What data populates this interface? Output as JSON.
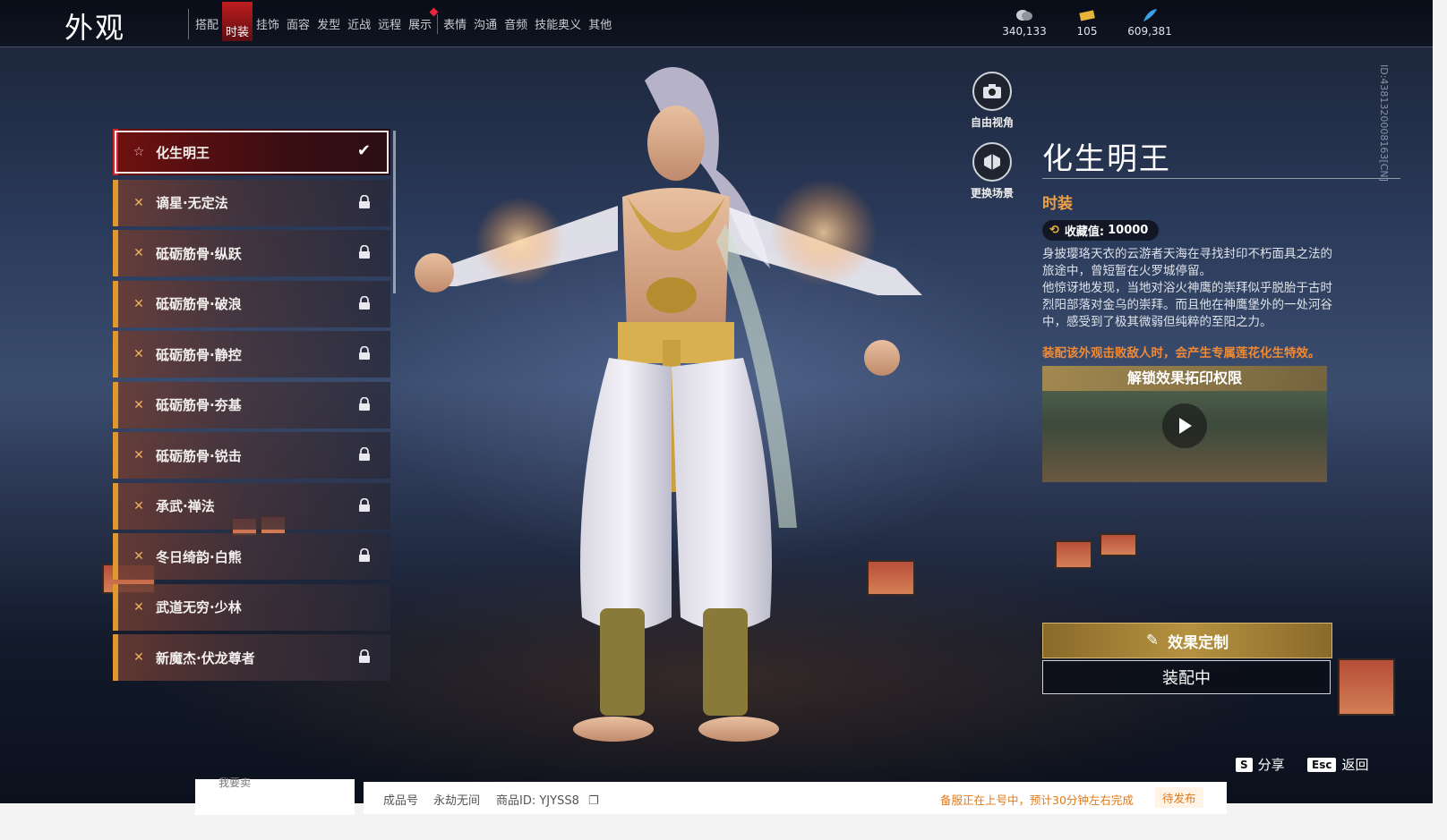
{
  "header": {
    "title": "外观",
    "tabs": [
      {
        "label": "搭配",
        "active": false
      },
      {
        "label": "时装",
        "active": true
      },
      {
        "label": "挂饰",
        "active": false
      },
      {
        "label": "面容",
        "active": false
      },
      {
        "label": "发型",
        "active": false
      },
      {
        "label": "近战",
        "active": false
      },
      {
        "label": "远程",
        "active": false
      },
      {
        "label": "展示",
        "active": false,
        "badge": true
      },
      {
        "label": "表情",
        "active": false
      },
      {
        "label": "沟通",
        "active": false
      },
      {
        "label": "音频",
        "active": false
      },
      {
        "label": "技能奥义",
        "active": false
      },
      {
        "label": "其他",
        "active": false
      }
    ],
    "currencies": [
      {
        "icon": "coin-icon",
        "value": "340,133"
      },
      {
        "icon": "ticket-icon",
        "value": "105"
      },
      {
        "icon": "feather-icon",
        "value": "609,381"
      }
    ]
  },
  "outfit_list": [
    {
      "label": "化生明王",
      "selected": true,
      "locked": false,
      "equipped": true
    },
    {
      "label": "谪星·无定法",
      "selected": false,
      "locked": true
    },
    {
      "label": "砥砺筋骨·纵跃",
      "selected": false,
      "locked": true
    },
    {
      "label": "砥砺筋骨·破浪",
      "selected": false,
      "locked": true
    },
    {
      "label": "砥砺筋骨·静控",
      "selected": false,
      "locked": true
    },
    {
      "label": "砥砺筋骨·夯基",
      "selected": false,
      "locked": true
    },
    {
      "label": "砥砺筋骨·锐击",
      "selected": false,
      "locked": true
    },
    {
      "label": "承武·禅法",
      "selected": false,
      "locked": true
    },
    {
      "label": "冬日绮韵·白熊",
      "selected": false,
      "locked": true
    },
    {
      "label": "武道无穷·少林",
      "selected": false,
      "locked": false
    },
    {
      "label": "新魔杰·伏龙尊者",
      "selected": false,
      "locked": true
    }
  ],
  "side_tools": [
    {
      "label": "自由视角",
      "icon": "camera-icon"
    },
    {
      "label": "更换场景",
      "icon": "scene-icon"
    }
  ],
  "detail": {
    "name": "化生明王",
    "type": "时装",
    "collect_label": "收藏值:",
    "collect_value": "10000",
    "description": "身披璎珞天衣的云游者天海在寻找封印不朽面具之法的旅途中，曾短暂在火罗城停留。\n他惊讶地发现，当地对浴火神鹰的崇拜似乎脱胎于古时烈阳部落对金乌的崇拜。而且他在神鹰堡外的一处河谷中，感受到了极其微弱但纯粹的至阳之力。",
    "effect": "装配该外观击败敌人时，会产生专属莲花化生特效。",
    "video_title": "解锁效果拓印权限",
    "custom_button": "效果定制",
    "equipped_button": "装配中"
  },
  "hints": {
    "share_key": "S",
    "share_label": "分享",
    "back_key": "Esc",
    "back_label": "返回"
  },
  "side_id": "ID:4381320008163[CN]",
  "page_footer": {
    "left_text": "我要卖",
    "product_label": "成品号",
    "server": "永劫无间",
    "product_id": "商品ID: YJYSS8",
    "notice": "备服正在上号中，预计30分钟左右完成",
    "status": "待发布"
  },
  "colors": {
    "accent_orange": "#e0972e",
    "selected_red": "#d2242c",
    "gold": "#b59240",
    "effect_text": "#ef8a36"
  }
}
